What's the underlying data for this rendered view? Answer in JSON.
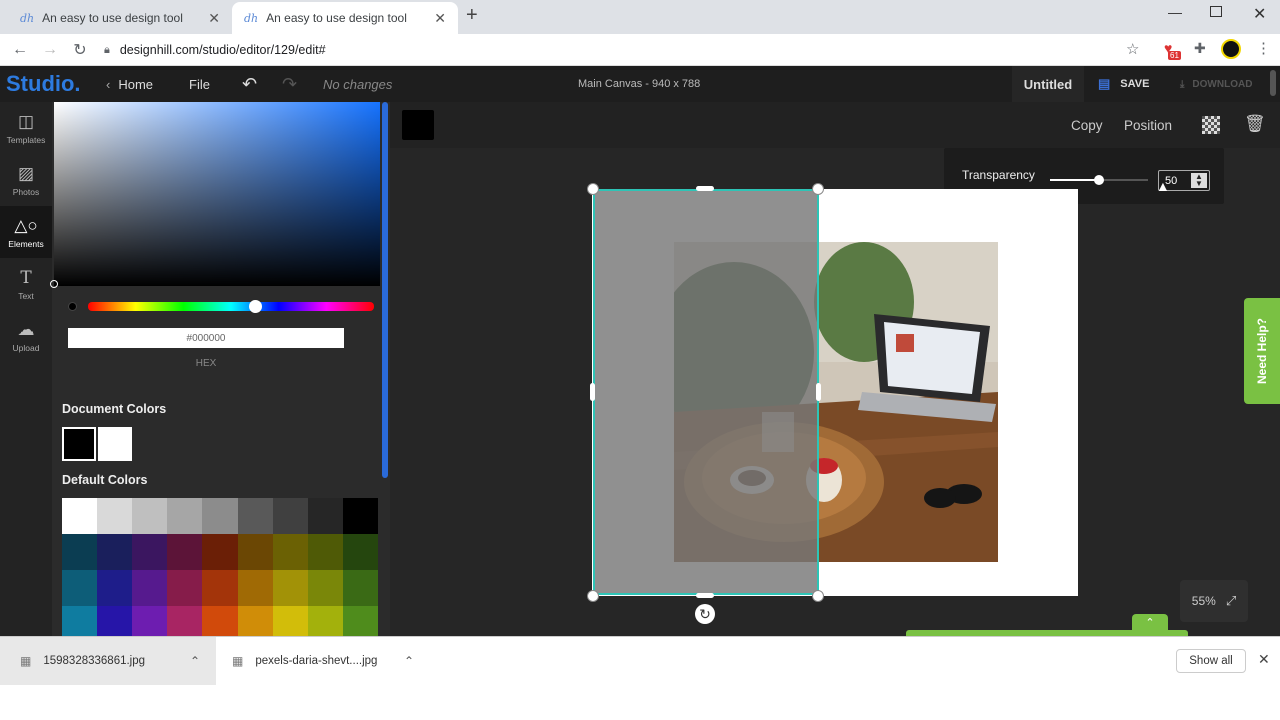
{
  "browser": {
    "tabs": [
      {
        "favicon": "dh",
        "title": "An easy to use design tool",
        "active": false
      },
      {
        "favicon": "dh",
        "title": "An easy to use design tool",
        "active": true
      }
    ],
    "url": "designhill.com/studio/editor/129/edit#",
    "extension_badge": "61"
  },
  "app": {
    "logo": "Studio.",
    "home_label": "Home",
    "file_label": "File",
    "status": "No changes",
    "canvas_info": "Main Canvas - 940 x 788",
    "doc_title": "Untitled",
    "save_label": "SAVE",
    "download_label": "DOWNLOAD"
  },
  "sidebar": {
    "items": [
      {
        "label": "Templates",
        "icon": "templates-icon",
        "active": false
      },
      {
        "label": "Photos",
        "icon": "photos-icon",
        "active": false
      },
      {
        "label": "Elements",
        "icon": "elements-icon",
        "active": true
      },
      {
        "label": "Text",
        "icon": "text-icon",
        "active": false
      },
      {
        "label": "Upload",
        "icon": "upload-icon",
        "active": false
      }
    ]
  },
  "color_panel": {
    "hex_value": "#000000",
    "hex_label": "HEX",
    "document_colors_title": "Document Colors",
    "document_colors": [
      "#000000",
      "#ffffff"
    ],
    "default_colors_title": "Default Colors",
    "default_colors": [
      "#ffffff",
      "#d9d9d9",
      "#bfbfbf",
      "#a6a6a6",
      "#8c8c8c",
      "#595959",
      "#404040",
      "#262626",
      "#000000",
      "#0b3d52",
      "#1a1f5c",
      "#3b1660",
      "#5c1438",
      "#6b1f06",
      "#6b4704",
      "#6b6104",
      "#4f5a06",
      "#25460e",
      "#0d5d78",
      "#1e1d8a",
      "#561a8e",
      "#861c4a",
      "#a3340a",
      "#a06a05",
      "#a29207",
      "#7a8709",
      "#3a6a15",
      "#0f7ca0",
      "#2615a8",
      "#6d1db0",
      "#a82563",
      "#d14a0b",
      "#d08d08",
      "#d2bd0a",
      "#a3b10c",
      "#4f8c1c"
    ]
  },
  "toolbar": {
    "copy_label": "Copy",
    "position_label": "Position",
    "transparency_label": "Transparency",
    "transparency_value": "50",
    "transparency_level": 0.5
  },
  "help_label": "Need Help?",
  "zoom_level": "55%",
  "downloads": {
    "files": [
      "1598328336861.jpg",
      "pexels-daria-shevt....jpg"
    ],
    "show_all_label": "Show all"
  }
}
